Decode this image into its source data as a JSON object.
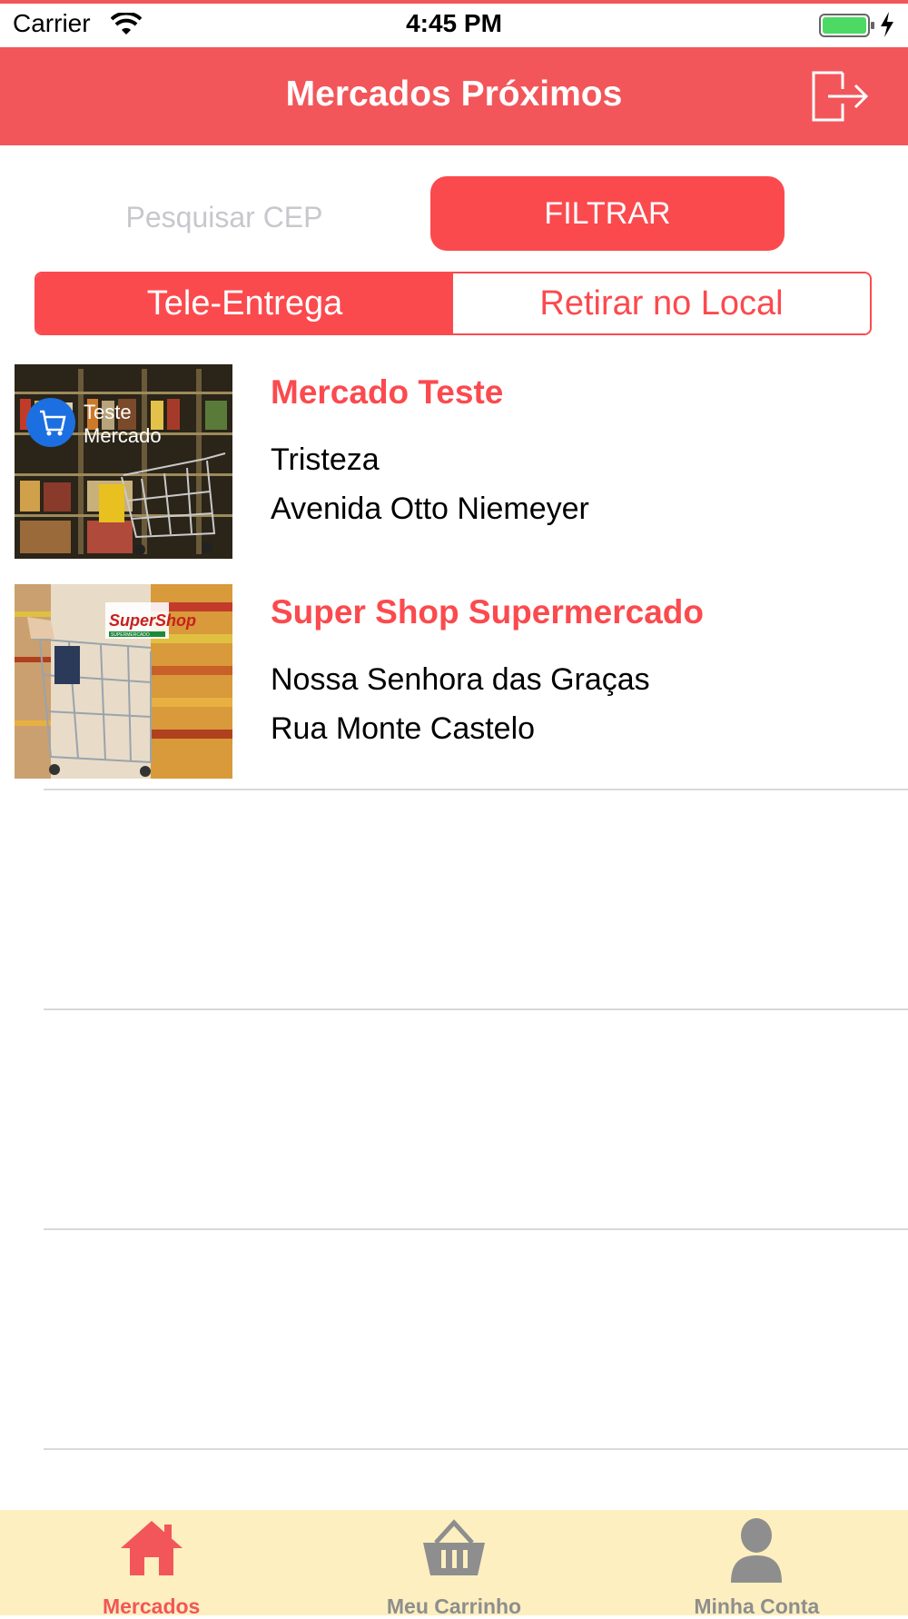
{
  "status_bar": {
    "carrier": "Carrier",
    "time": "4:45 PM"
  },
  "nav": {
    "title": "Mercados Próximos",
    "logout_icon": "logout-icon"
  },
  "search": {
    "placeholder": "Pesquisar CEP",
    "filter_label": "FILTRAR"
  },
  "segments": {
    "delivery": "Tele-Entrega",
    "pickup": "Retirar no Local",
    "selected": "delivery"
  },
  "markets": [
    {
      "name": "Mercado Teste",
      "neighborhood": "Tristeza",
      "street": "Avenida Otto Niemeyer",
      "image_text": [
        "Teste",
        "Mercado"
      ]
    },
    {
      "name": "Super Shop Supermercado",
      "neighborhood": "Nossa Senhora das Graças",
      "street": "Rua Monte Castelo",
      "image_text": [
        "SuperShop",
        "SUPERMERCADO"
      ]
    }
  ],
  "tabbar": {
    "tabs": [
      {
        "label": "Mercados",
        "icon": "home-icon",
        "active": true
      },
      {
        "label": "Meu Carrinho",
        "icon": "basket-icon",
        "active": false
      },
      {
        "label": "Minha Conta",
        "icon": "person-icon",
        "active": false
      }
    ]
  },
  "colors": {
    "accent": "#fb4a4e",
    "navbar": "#f2565a",
    "tabbar_bg": "#fdefbf",
    "tab_inactive": "#8e8e8e",
    "battery": "#4cd964"
  }
}
